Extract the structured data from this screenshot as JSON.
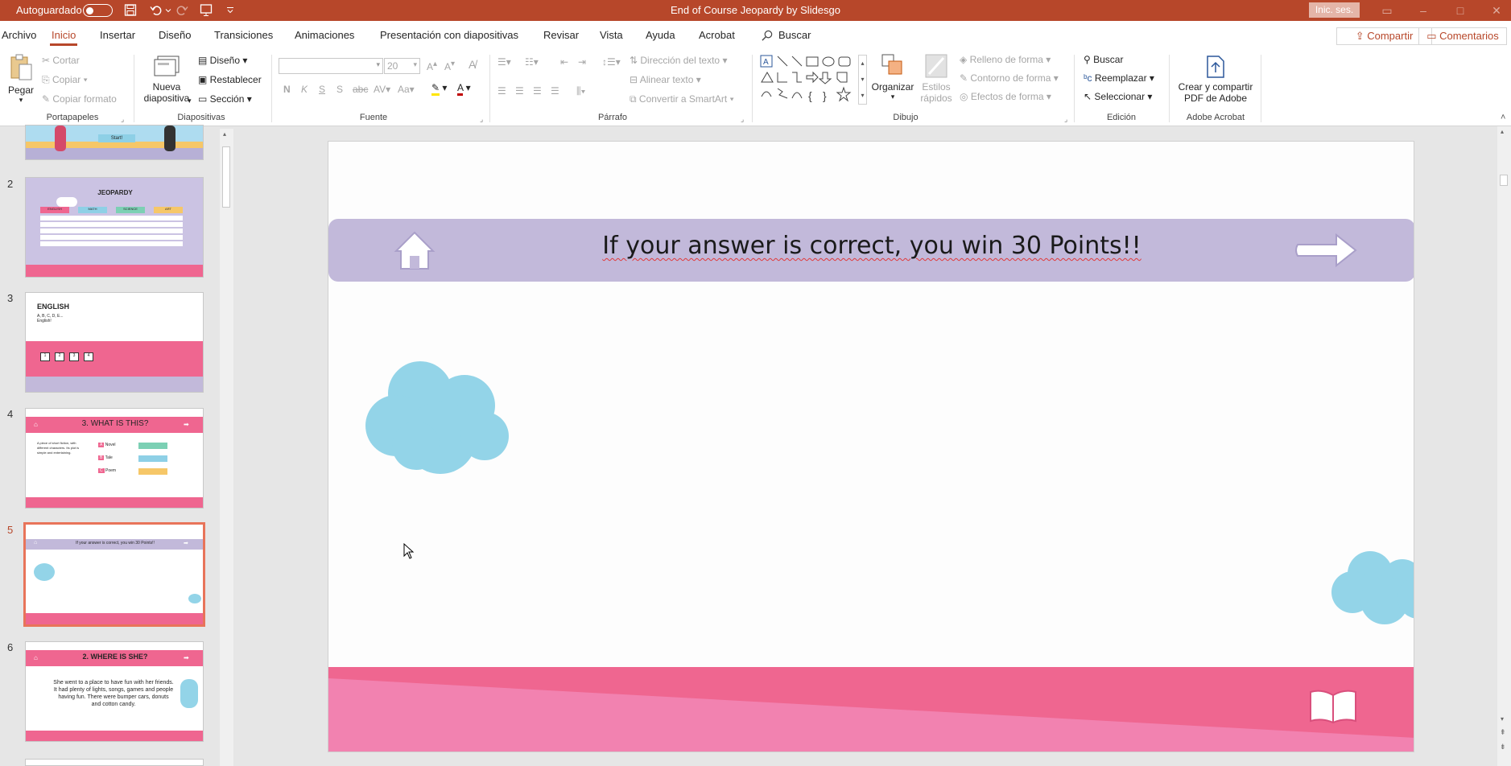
{
  "titlebar": {
    "autosave_label": "Autoguardado",
    "doc_title": "End of Course Jeopardy by Slidesgo",
    "signin_label": "Inic. ses."
  },
  "tabs": {
    "items": [
      "Archivo",
      "Inicio",
      "Insertar",
      "Diseño",
      "Transiciones",
      "Animaciones",
      "Presentación con diapositivas",
      "Revisar",
      "Vista",
      "Ayuda",
      "Acrobat"
    ],
    "active": "Inicio",
    "search_label": "Buscar",
    "share_label": "Compartir",
    "comments_label": "Comentarios"
  },
  "ribbon": {
    "clipboard": {
      "paste": "Pegar",
      "cut": "Cortar",
      "copy": "Copiar",
      "format_painter": "Copiar formato",
      "label": "Portapapeles"
    },
    "slides": {
      "new_slide_1": "Nueva",
      "new_slide_2": "diapositiva",
      "layout": "Diseño",
      "reset": "Restablecer",
      "section": "Sección",
      "label": "Diapositivas"
    },
    "font": {
      "font_name": "",
      "font_size": "20",
      "label": "Fuente"
    },
    "paragraph": {
      "text_direction": "Dirección del texto",
      "align_text": "Alinear texto",
      "smartart": "Convertir a SmartArt",
      "label": "Párrafo"
    },
    "drawing": {
      "arrange": "Organizar",
      "quick_styles_1": "Estilos",
      "quick_styles_2": "rápidos",
      "shape_fill": "Relleno de forma",
      "shape_outline": "Contorno de forma",
      "shape_effects": "Efectos de forma",
      "label": "Dibujo"
    },
    "editing": {
      "find": "Buscar",
      "replace": "Reemplazar",
      "select": "Seleccionar",
      "label": "Edición"
    },
    "acrobat": {
      "create_1": "Crear y compartir",
      "create_2": "PDF de Adobe",
      "label": "Adobe Acrobat"
    }
  },
  "thumbnails": {
    "numbers": [
      "2",
      "3",
      "4",
      "5",
      "6"
    ],
    "s2_title": "JEOPARDY",
    "s2_cols": [
      "ENGLISH",
      "MATH",
      "SCIENCE",
      "ART"
    ],
    "s3_title": "ENGLISH",
    "s3_sub1": "A, B, C, D, E...",
    "s3_sub2": "English!",
    "s3_boxes": [
      "1",
      "2",
      "3",
      "4"
    ],
    "s4_title": "3. WHAT IS THIS?",
    "s4_body": "A piece of short fiction, with different characters. Its plot is simple and entertaining.",
    "s4_options": [
      {
        "letter": "A",
        "text": "Novel"
      },
      {
        "letter": "B",
        "text": "Tale"
      },
      {
        "letter": "C",
        "text": "Poem"
      }
    ],
    "s5_title": "If your answer is correct, you win 30 Points!!",
    "s6_title": "2. WHERE IS SHE?",
    "s6_body": "She went to a place to have fun with her friends. It had plenty of lights, songs, games and people having fun. There were bumper cars, donuts and cotton candy.",
    "s1_start": "Start!",
    "active_slide": "5"
  },
  "slide": {
    "title": "If your answer is correct, you win 30 Points!!"
  },
  "colors": {
    "accent": "#b7472a",
    "banner": "#c2b9da",
    "pink": "#ef6690",
    "cloud": "#93d4e8"
  }
}
